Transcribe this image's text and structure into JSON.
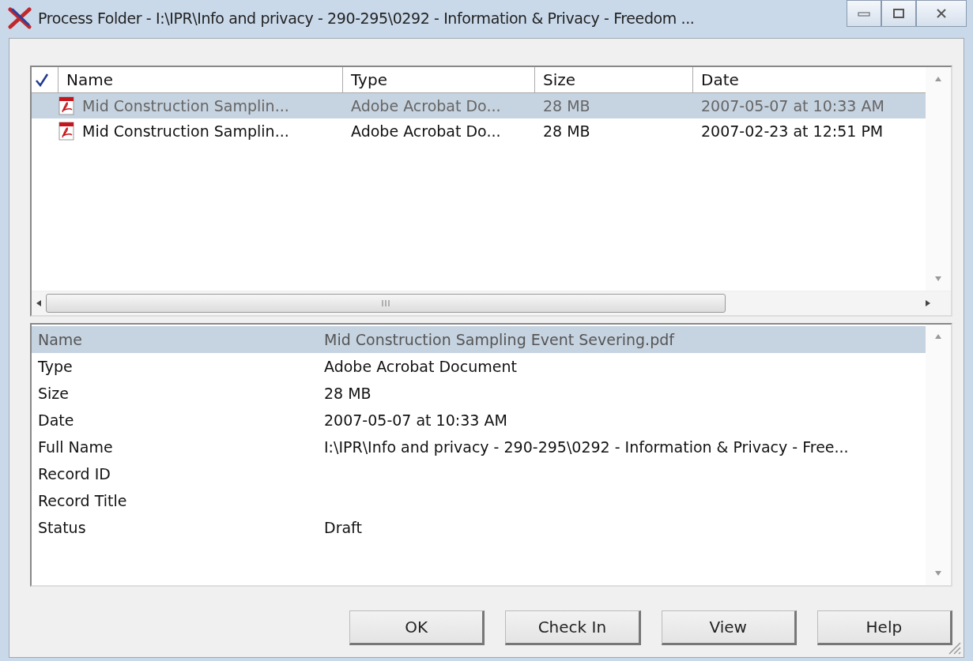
{
  "window": {
    "title": "Process Folder - I:\\IPR\\Info and privacy - 290-295\\0292 - Information & Privacy - Freedom ..."
  },
  "file_list": {
    "columns": [
      "Name",
      "Type",
      "Size",
      "Date"
    ],
    "rows": [
      {
        "name": "Mid Construction Samplin...",
        "type": "Adobe Acrobat Do...",
        "size": "28 MB",
        "date": "2007-05-07 at 10:33 AM",
        "selected": true
      },
      {
        "name": "Mid Construction Samplin...",
        "type": "Adobe Acrobat Do...",
        "size": "28 MB",
        "date": "2007-02-23 at 12:51 PM",
        "selected": false
      }
    ]
  },
  "properties": [
    {
      "label": "Name",
      "value": "Mid Construction Sampling Event Severing.pdf",
      "selected": true
    },
    {
      "label": "Type",
      "value": "Adobe Acrobat Document",
      "selected": false
    },
    {
      "label": "Size",
      "value": "28 MB",
      "selected": false
    },
    {
      "label": "Date",
      "value": "2007-05-07 at 10:33 AM",
      "selected": false
    },
    {
      "label": "Full Name",
      "value": "I:\\IPR\\Info and privacy - 290-295\\0292 - Information & Privacy - Free...",
      "selected": false
    },
    {
      "label": "Record ID",
      "selected": false
    },
    {
      "label": "Record Title",
      "selected": false
    },
    {
      "label": "Status",
      "value": "Draft",
      "selected": false
    }
  ],
  "buttons": [
    "OK",
    "Check In",
    "View",
    "Help"
  ]
}
